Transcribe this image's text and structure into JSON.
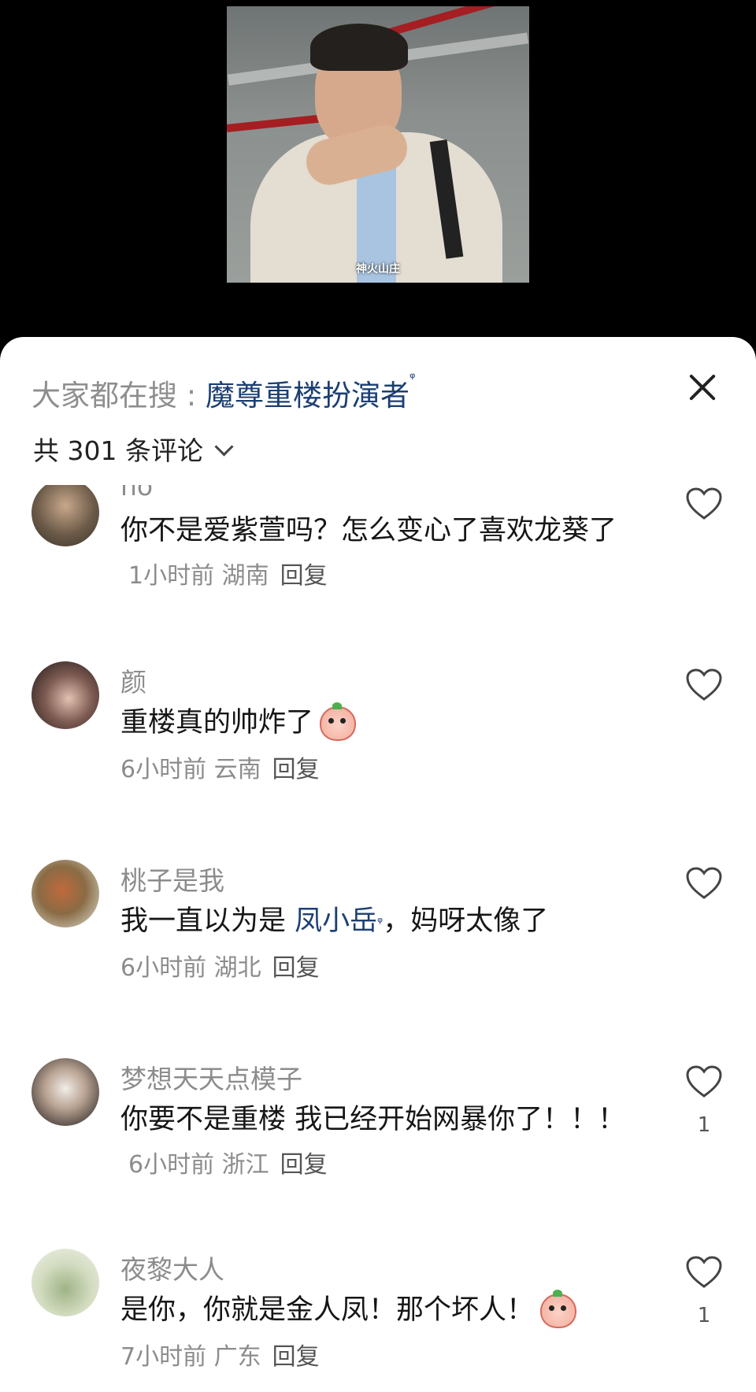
{
  "video": {
    "caption": "神火山庄"
  },
  "search": {
    "prefix": "大家都在搜 : ",
    "term": "魔尊重楼扮演者"
  },
  "comment_count_label": "共 301 条评论",
  "comments": [
    {
      "username": "no",
      "text": "你不是爱紫萱吗？怎么变心了喜欢龙葵了",
      "time": "1小时前",
      "location": "湖南",
      "reply": "回复",
      "likes": ""
    },
    {
      "username": "颜",
      "text": "重楼真的帅炸了",
      "time": "6小时前",
      "location": "云南",
      "reply": "回复",
      "likes": "",
      "emoji": "cry-peach-emoji"
    },
    {
      "username": "桃子是我",
      "text_before": "我一直以为是 ",
      "mention": "凤小岳",
      "text_after": "，妈呀太像了",
      "time": "6小时前",
      "location": "湖北",
      "reply": "回复",
      "likes": ""
    },
    {
      "username": "梦想天天点模子",
      "text": "你要不是重楼 我已经开始网暴你了！！！",
      "time": "6小时前",
      "location": "浙江",
      "reply": "回复",
      "likes": "1"
    },
    {
      "username": "夜黎大人",
      "text": "是你，你就是金人凤！那个坏人！",
      "time": "7小时前",
      "location": "广东",
      "reply": "回复",
      "likes": "1",
      "emoji": "thinking-peach-emoji"
    }
  ],
  "colors": {
    "mention": "#1c3f73",
    "muted": "#8c8c8c",
    "text": "#161616"
  }
}
